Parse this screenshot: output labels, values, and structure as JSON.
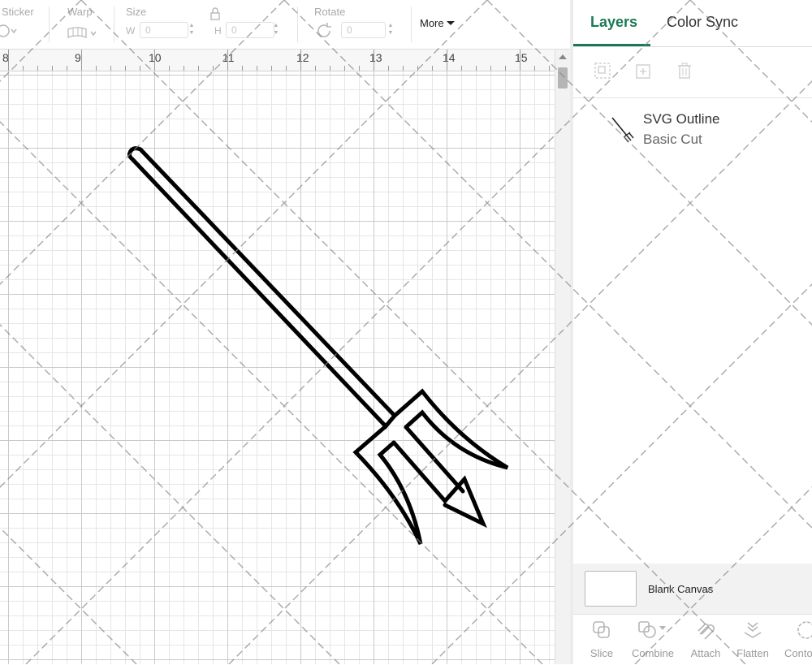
{
  "toolbar": {
    "sticker_label": "Sticker",
    "warp_label": "Warp",
    "size_label": "Size",
    "size_w_prefix": "W",
    "size_w_value": "0",
    "size_h_prefix": "H",
    "size_h_value": "0",
    "rotate_label": "Rotate",
    "rotate_value": "0",
    "more_label": "More"
  },
  "ruler": {
    "numbers": [
      "8",
      "9",
      "10",
      "11",
      "12",
      "13",
      "14",
      "15"
    ]
  },
  "panel": {
    "tabs": [
      {
        "label": "Layers",
        "active": true
      },
      {
        "label": "Color Sync",
        "active": false
      }
    ],
    "layer": {
      "title": "SVG Outline",
      "subtitle": "Basic Cut"
    },
    "blank_canvas_label": "Blank Canvas",
    "actions": [
      {
        "label": "Slice",
        "icon": "slice-icon"
      },
      {
        "label": "Combine",
        "icon": "combine-icon"
      },
      {
        "label": "Attach",
        "icon": "attach-icon"
      },
      {
        "label": "Flatten",
        "icon": "flatten-icon"
      },
      {
        "label": "Conto",
        "icon": "contour-icon"
      }
    ]
  },
  "colors": {
    "accent": "#1a7a55",
    "grid_major": "#c9c9c9",
    "grid_minor": "#e6e6e6"
  }
}
